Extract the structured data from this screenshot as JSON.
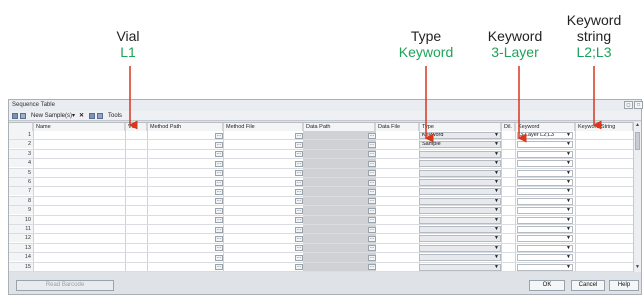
{
  "callouts": {
    "vial": {
      "title": "Vial",
      "value": "L1"
    },
    "type": {
      "title": "Type",
      "value": "Keyword"
    },
    "keyword": {
      "title": "Keyword",
      "value": "3-Layer"
    },
    "keyword_string": {
      "title_line1": "Keyword",
      "title_line2": "string",
      "value": "L2;L3"
    }
  },
  "window": {
    "title": "Sequence Table",
    "toolbar": {
      "new_samples_label": "New Sample(s)",
      "tools_label": "Tools"
    }
  },
  "table": {
    "headers": {
      "name": "Name",
      "vial": "Vial",
      "method_path": "Method Path",
      "method_file": "Method File",
      "data_path": "Data Path",
      "data_file": "Data File",
      "type": "Type",
      "dil": "Dil.",
      "keyword": "Keyword",
      "keyword_string": "Keyword String"
    },
    "row_numbers": [
      "1",
      "2",
      "3",
      "4",
      "5",
      "6",
      "7",
      "8",
      "9",
      "10",
      "11",
      "12",
      "13",
      "14",
      "15"
    ],
    "type_values": [
      "Keyword",
      "Sample"
    ],
    "keyword_values": [
      "3-Layer L2;L3"
    ]
  },
  "footer": {
    "read_barcode_label": "Read Barcode",
    "ok_label": "OK",
    "cancel_label": "Cancel",
    "help_label": "Help"
  },
  "colors": {
    "accent_green": "#1fa35a",
    "arrow_red": "#d9361c"
  }
}
